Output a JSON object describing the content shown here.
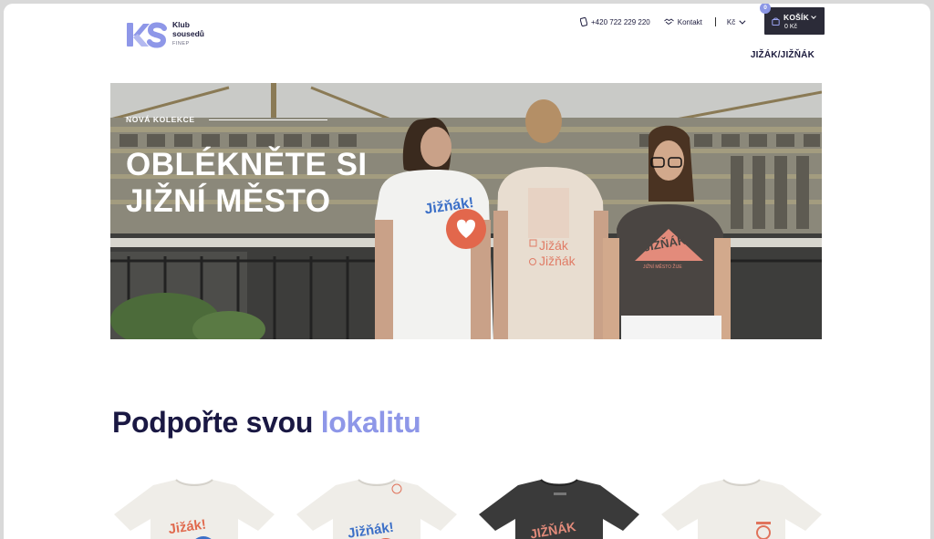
{
  "header": {
    "logo_line1": "Klub",
    "logo_line2": "sousedů",
    "logo_sub": "FINEP",
    "phone": "+420 722 229 220",
    "contact": "Kontakt",
    "currency": "Kč",
    "cart_label": "KOŠÍK",
    "cart_count": "0",
    "cart_price": "0 Kč",
    "nav_link": "JIŽÁK/JIŽŇÁK"
  },
  "hero": {
    "eyebrow": "NOVÁ KOLEKCE",
    "title_line1": "OBLÉKNĚTE SI",
    "title_line2": "JIŽNÍ MĚSTO",
    "shirt1_text": "Jižňák!",
    "shirt2_text1": "Jižák",
    "shirt2_text2": "Jižňák",
    "shirt3_text": "JIŽŇÁK",
    "shirt3_sub": "JIŽNÍ MĚSTO ŽIJE"
  },
  "section": {
    "title_main": "Podpořte svou",
    "title_accent": "lokalitu"
  },
  "products": [
    {
      "print_text": "Jižák!",
      "shirt_color": "#efede8",
      "print_color": "#e06a4e"
    },
    {
      "print_text": "Jižňák!",
      "shirt_color": "#efede8",
      "print_color": "#3b6fc7"
    },
    {
      "print_text": "JIŽŇÁK",
      "shirt_color": "#3a3a3a",
      "print_color": "#e38b7b"
    },
    {
      "print_text": "",
      "shirt_color": "#efede8",
      "print_color": "#e0745c"
    }
  ],
  "colors": {
    "brand_purple": "#8e97e8",
    "navy": "#1a1843",
    "cart_bg": "#2b2b38"
  }
}
